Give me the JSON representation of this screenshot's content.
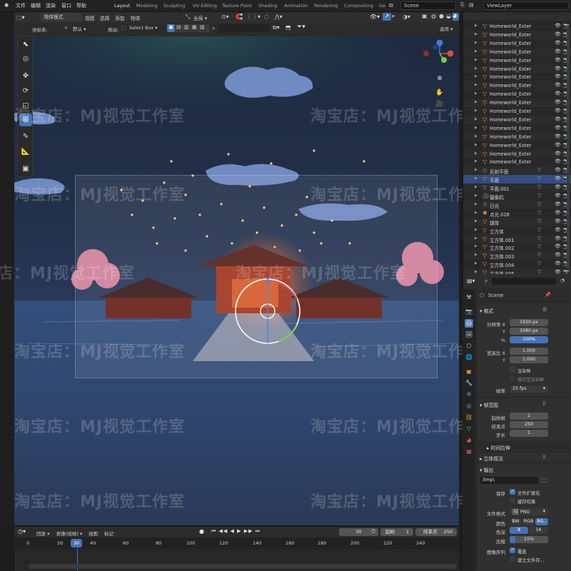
{
  "app": {
    "brand_icon": "blender-logo"
  },
  "menu": [
    "文件",
    "编辑",
    "渲染",
    "窗口",
    "帮助"
  ],
  "workspaces": [
    "Layout",
    "Modeling",
    "Sculpting",
    "UV Editing",
    "Texture Paint",
    "Shading",
    "Animation",
    "Rendering",
    "Compositing",
    "Ge"
  ],
  "active_workspace": "Layout",
  "scene": {
    "label": "Scene"
  },
  "view_layer": {
    "label": "ViewLayer"
  },
  "viewport_header": {
    "mode": "物体模式",
    "menus": [
      "视图",
      "选择",
      "添加",
      "物体"
    ],
    "transform_space": "全局",
    "coord_label": "坐标系:",
    "coord_value": "默认",
    "drag_label": "拖动:",
    "drag_value": "Select Box",
    "options_label": "选项"
  },
  "toolbar_tools": [
    {
      "icon": "cursor-select-icon",
      "glyph": "⬉"
    },
    {
      "icon": "3d-cursor-icon",
      "glyph": "◎"
    },
    {
      "icon": "move-icon",
      "glyph": "✥"
    },
    {
      "icon": "rotate-icon",
      "glyph": "⟳"
    },
    {
      "icon": "scale-icon",
      "glyph": "◱"
    },
    {
      "icon": "transform-icon",
      "glyph": "⊞"
    },
    {
      "icon": "annotate-icon",
      "glyph": "✎"
    },
    {
      "icon": "measure-icon",
      "glyph": "📐"
    },
    {
      "icon": "add-cube-icon",
      "glyph": "▣"
    }
  ],
  "watermark_text": "淘宝店：MJ视觉工作室",
  "outliner": {
    "items": [
      {
        "name": "Homeworld_Exter",
        "icon": "mesh-icon"
      },
      {
        "name": "Homeworld_Exter",
        "icon": "mesh-icon"
      },
      {
        "name": "Homeworld_Exter",
        "icon": "mesh-icon"
      },
      {
        "name": "Homeworld_Exter",
        "icon": "mesh-icon"
      },
      {
        "name": "Homeworld_Exter",
        "icon": "mesh-icon"
      },
      {
        "name": "Homeworld_Exter",
        "icon": "mesh-icon"
      },
      {
        "name": "Homeworld_Exter",
        "icon": "mesh-icon"
      },
      {
        "name": "Homeworld_Exter",
        "icon": "mesh-icon"
      },
      {
        "name": "Homeworld_Exter",
        "icon": "mesh-icon"
      },
      {
        "name": "Homeworld_Exter",
        "icon": "mesh-icon"
      },
      {
        "name": "Homeworld_Exter",
        "icon": "mesh-icon"
      },
      {
        "name": "Homeworld_Exter",
        "icon": "mesh-icon"
      },
      {
        "name": "Homeworld_Exter",
        "icon": "mesh-icon"
      },
      {
        "name": "Homeworld_Exter",
        "icon": "mesh-icon"
      },
      {
        "name": "Homeworld_Exter",
        "icon": "mesh-icon"
      },
      {
        "name": "Homeworld_Exter",
        "icon": "mesh-icon"
      },
      {
        "name": "Homeworld_Exter",
        "icon": "mesh-icon"
      },
      {
        "name": "反射平面",
        "icon": "light-probe-icon"
      },
      {
        "name": "平面",
        "icon": "mesh-icon",
        "selected": true
      },
      {
        "name": "平面.001",
        "icon": "mesh-icon"
      },
      {
        "name": "摄像机",
        "icon": "camera-icon"
      },
      {
        "name": "日光",
        "icon": "sun-icon"
      },
      {
        "name": "点光.028",
        "icon": "point-light-icon"
      },
      {
        "name": "球体",
        "icon": "mesh-icon"
      },
      {
        "name": "立方体",
        "icon": "mesh-icon"
      },
      {
        "name": "立方体.001",
        "icon": "mesh-icon"
      },
      {
        "name": "立方体.002",
        "icon": "mesh-icon"
      },
      {
        "name": "立方体.003",
        "icon": "mesh-icon"
      },
      {
        "name": "立方体.004",
        "icon": "mesh-icon"
      },
      {
        "name": "立方体.005",
        "icon": "mesh-icon"
      }
    ]
  },
  "properties": {
    "scene_name": "Scene",
    "format_header": "格式",
    "resolution_x_label": "分辨率 X",
    "resolution_x": "1920 px",
    "resolution_y_label": "Y",
    "resolution_y": "1080 px",
    "percent_label": "%",
    "percent": "100%",
    "aspect_x_label": "宽高比 X",
    "aspect_x": "1.000",
    "aspect_y_label": "Y",
    "aspect_y": "1.000",
    "render_region": "渲染框",
    "crop_region": "裁切至渲染框",
    "fps_label": "帧率",
    "fps": "25 fps",
    "frame_range_header": "帧范围",
    "frame_start_label": "起始帧",
    "frame_start": "1",
    "frame_end_label": "结束点",
    "frame_end": "250",
    "frame_step_label": "步长",
    "frame_step": "1",
    "time_stretch": "时间拉伸",
    "stereoscopy": "立体视法",
    "output_header": "输出",
    "output_path": "/tmp\\",
    "save_label": "保存",
    "file_ext": "文件扩展名",
    "cache_result": "缓存结果",
    "file_format_label": "文件格式",
    "file_format": "PNG",
    "color_label": "颜色",
    "color_options": [
      "BW",
      "RGB",
      "RG.."
    ],
    "depth_label": "色深",
    "depth_options": [
      "8",
      "16"
    ],
    "compression_label": "压缩",
    "compression": "15%",
    "compression_value": 0.15,
    "image_seq_label": "图像序列",
    "overwrite": "覆盖",
    "placeholders": "建立文件存..."
  },
  "timeline": {
    "menus": [
      "回放",
      "抠像(插帧)",
      "视图",
      "标记"
    ],
    "current_frame": "30",
    "start_label": "起始",
    "start": "1",
    "end_label": "结束点",
    "end": "250",
    "ruler": [
      "0",
      "20",
      "30",
      "40",
      "60",
      "80",
      "100",
      "120",
      "140",
      "160",
      "180",
      "200",
      "220",
      "240"
    ]
  }
}
